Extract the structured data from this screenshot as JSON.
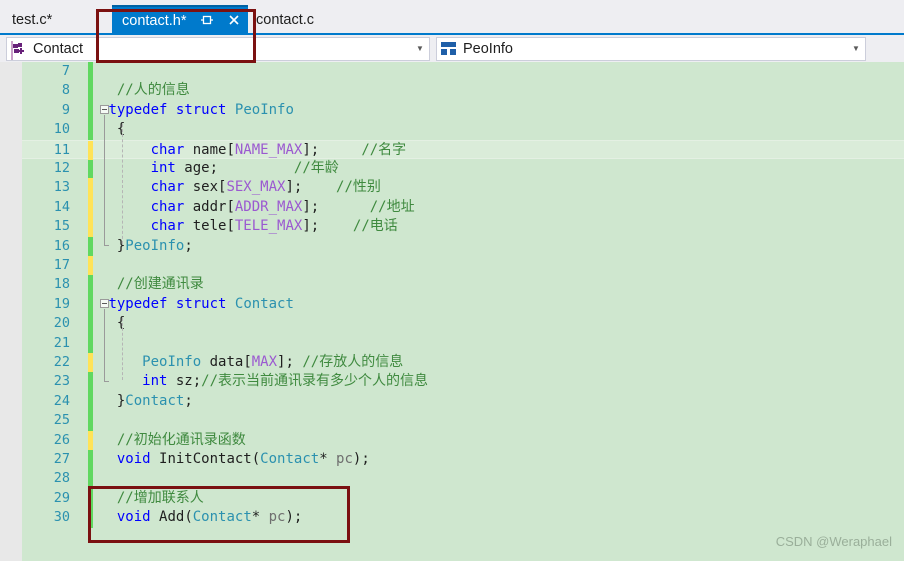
{
  "window": {
    "accent_color": "#007acc",
    "editor_background": "#cfe7cf"
  },
  "tabs": [
    {
      "label": "test.c*",
      "active": false
    },
    {
      "label": "contact.h*",
      "active": true,
      "pin_icon": "pin-icon",
      "close_icon": "close-icon"
    },
    {
      "label": "contact.c",
      "active": false
    }
  ],
  "navbar": {
    "left_combo": {
      "icon": "struct-icon",
      "value": "Contact",
      "arrow": "chevron-down-icon"
    },
    "right_combo": {
      "icon": "struct-icon",
      "value": "PeoInfo",
      "arrow": "chevron-down-icon"
    }
  },
  "editor": {
    "language": "c",
    "first_visible_line": 7,
    "current_line": 11,
    "lines": [
      {
        "n": 7,
        "change": "green",
        "tokens": []
      },
      {
        "n": 8,
        "change": "green",
        "tokens": [
          {
            "t": "  ",
            "c": "pln"
          },
          {
            "t": "//人的信息",
            "c": "cmt"
          }
        ]
      },
      {
        "n": 9,
        "change": "green",
        "tokens": [
          {
            "t": " ",
            "c": "pln"
          },
          {
            "t": "typedef",
            "c": "kw"
          },
          {
            "t": " ",
            "c": "pln"
          },
          {
            "t": "struct",
            "c": "kw"
          },
          {
            "t": " ",
            "c": "pln"
          },
          {
            "t": "PeoInfo",
            "c": "typ"
          }
        ]
      },
      {
        "n": 10,
        "change": "green",
        "tokens": [
          {
            "t": "  {",
            "c": "pln"
          }
        ]
      },
      {
        "n": 11,
        "change": "yellow",
        "tokens": [
          {
            "t": "      ",
            "c": "pln"
          },
          {
            "t": "char",
            "c": "kw"
          },
          {
            "t": " name[",
            "c": "pln"
          },
          {
            "t": "NAME_MAX",
            "c": "mac"
          },
          {
            "t": "];     ",
            "c": "pln"
          },
          {
            "t": "//名字",
            "c": "cmt"
          }
        ]
      },
      {
        "n": 12,
        "change": "green",
        "tokens": [
          {
            "t": "      ",
            "c": "pln"
          },
          {
            "t": "int",
            "c": "kw"
          },
          {
            "t": " age;         ",
            "c": "pln"
          },
          {
            "t": "//年龄",
            "c": "cmt"
          }
        ]
      },
      {
        "n": 13,
        "change": "yellow",
        "tokens": [
          {
            "t": "      ",
            "c": "pln"
          },
          {
            "t": "char",
            "c": "kw"
          },
          {
            "t": " sex[",
            "c": "pln"
          },
          {
            "t": "SEX_MAX",
            "c": "mac"
          },
          {
            "t": "];    ",
            "c": "pln"
          },
          {
            "t": "//性别",
            "c": "cmt"
          }
        ]
      },
      {
        "n": 14,
        "change": "yellow",
        "tokens": [
          {
            "t": "      ",
            "c": "pln"
          },
          {
            "t": "char",
            "c": "kw"
          },
          {
            "t": " addr[",
            "c": "pln"
          },
          {
            "t": "ADDR_MAX",
            "c": "mac"
          },
          {
            "t": "];      ",
            "c": "pln"
          },
          {
            "t": "//地址",
            "c": "cmt"
          }
        ]
      },
      {
        "n": 15,
        "change": "yellow",
        "tokens": [
          {
            "t": "      ",
            "c": "pln"
          },
          {
            "t": "char",
            "c": "kw"
          },
          {
            "t": " tele[",
            "c": "pln"
          },
          {
            "t": "TELE_MAX",
            "c": "mac"
          },
          {
            "t": "];    ",
            "c": "pln"
          },
          {
            "t": "//电话",
            "c": "cmt"
          }
        ]
      },
      {
        "n": 16,
        "change": "green",
        "tokens": [
          {
            "t": "  }",
            "c": "pln"
          },
          {
            "t": "PeoInfo",
            "c": "typ"
          },
          {
            "t": ";",
            "c": "pln"
          }
        ]
      },
      {
        "n": 17,
        "change": "yellow",
        "tokens": []
      },
      {
        "n": 18,
        "change": "green",
        "tokens": [
          {
            "t": "  ",
            "c": "pln"
          },
          {
            "t": "//创建通讯录",
            "c": "cmt"
          }
        ]
      },
      {
        "n": 19,
        "change": "green",
        "tokens": [
          {
            "t": " ",
            "c": "pln"
          },
          {
            "t": "typedef",
            "c": "kw"
          },
          {
            "t": " ",
            "c": "pln"
          },
          {
            "t": "struct",
            "c": "kw"
          },
          {
            "t": " ",
            "c": "pln"
          },
          {
            "t": "Contact",
            "c": "typ"
          }
        ]
      },
      {
        "n": 20,
        "change": "green",
        "tokens": [
          {
            "t": "  {",
            "c": "pln"
          }
        ]
      },
      {
        "n": 21,
        "change": "green",
        "tokens": []
      },
      {
        "n": 22,
        "change": "yellow",
        "tokens": [
          {
            "t": "     ",
            "c": "pln"
          },
          {
            "t": "PeoInfo",
            "c": "typ"
          },
          {
            "t": " data[",
            "c": "pln"
          },
          {
            "t": "MAX",
            "c": "mac"
          },
          {
            "t": "]; ",
            "c": "pln"
          },
          {
            "t": "//存放人的信息",
            "c": "cmt"
          }
        ]
      },
      {
        "n": 23,
        "change": "green",
        "tokens": [
          {
            "t": "     ",
            "c": "pln"
          },
          {
            "t": "int",
            "c": "kw"
          },
          {
            "t": " sz;",
            "c": "pln"
          },
          {
            "t": "//表示当前通讯录有多少个人的信息",
            "c": "cmt"
          }
        ]
      },
      {
        "n": 24,
        "change": "green",
        "tokens": [
          {
            "t": "  }",
            "c": "pln"
          },
          {
            "t": "Contact",
            "c": "typ"
          },
          {
            "t": ";",
            "c": "pln"
          }
        ]
      },
      {
        "n": 25,
        "change": "green",
        "tokens": []
      },
      {
        "n": 26,
        "change": "yellow",
        "tokens": [
          {
            "t": "  ",
            "c": "pln"
          },
          {
            "t": "//初始化通讯录函数",
            "c": "cmt"
          }
        ]
      },
      {
        "n": 27,
        "change": "green",
        "tokens": [
          {
            "t": "  ",
            "c": "pln"
          },
          {
            "t": "void",
            "c": "kw"
          },
          {
            "t": " ",
            "c": "pln"
          },
          {
            "t": "InitContact",
            "c": "pln"
          },
          {
            "t": "(",
            "c": "pln"
          },
          {
            "t": "Contact",
            "c": "typ"
          },
          {
            "t": "* ",
            "c": "pln"
          },
          {
            "t": "pc",
            "c": "gry"
          },
          {
            "t": ");",
            "c": "pln"
          }
        ]
      },
      {
        "n": 28,
        "change": "green",
        "tokens": []
      },
      {
        "n": 29,
        "change": "green",
        "tokens": [
          {
            "t": "  ",
            "c": "pln"
          },
          {
            "t": "//增加联系人",
            "c": "cmt"
          }
        ]
      },
      {
        "n": 30,
        "change": "green",
        "tokens": [
          {
            "t": "  ",
            "c": "pln"
          },
          {
            "t": "void",
            "c": "kw"
          },
          {
            "t": " ",
            "c": "pln"
          },
          {
            "t": "Add",
            "c": "pln"
          },
          {
            "t": "(",
            "c": "pln"
          },
          {
            "t": "Contact",
            "c": "typ"
          },
          {
            "t": "* ",
            "c": "pln"
          },
          {
            "t": "pc",
            "c": "gry"
          },
          {
            "t": ");",
            "c": "pln"
          }
        ]
      }
    ]
  },
  "annotations": [
    {
      "name": "tab-highlight",
      "color": "#7b1111"
    },
    {
      "name": "add-func-highlight",
      "color": "#7b1111"
    }
  ],
  "watermark": {
    "text": "CSDN @Weraphael"
  }
}
